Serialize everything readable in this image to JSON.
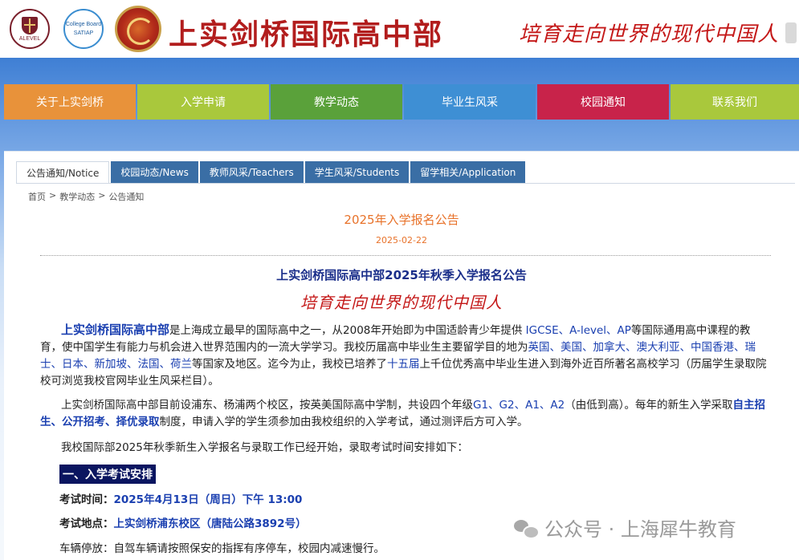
{
  "header": {
    "logo_alevel_text": "ALEVEL",
    "logo_cb_text": "College Board",
    "logo_cb_sub": "SATIAP",
    "school_name": "上实剑桥国际高中部",
    "slogan": "培育走向世界的现代中国人"
  },
  "nav": {
    "items": [
      {
        "label": "关于上实剑桥",
        "color": "#e8923a"
      },
      {
        "label": "入学申请",
        "color": "#a9c83c"
      },
      {
        "label": "教学动态",
        "color": "#5aa13a"
      },
      {
        "label": "毕业生风采",
        "color": "#3e8fd4"
      },
      {
        "label": "校园通知",
        "color": "#c8234a"
      },
      {
        "label": "联系我们",
        "color": "#a9c83c"
      }
    ]
  },
  "tabs": [
    {
      "label": "公告通知/Notice"
    },
    {
      "label": "校园动态/News"
    },
    {
      "label": "教师风采/Teachers"
    },
    {
      "label": "学生风采/Students"
    },
    {
      "label": "留学相关/Application"
    }
  ],
  "breadcrumb": {
    "home": "首页",
    "sep": ">",
    "level1": "教学动态",
    "level2": "公告通知"
  },
  "article": {
    "title": "2025年入学报名公告",
    "date": "2025-02-22",
    "heading": "上实剑桥国际高中部2025年秋季入学报名公告",
    "slogan": "培育走向世界的现代中国人",
    "p1": {
      "lead": "上实剑桥国际高中部",
      "a": "是上海成立最早的国际高中之一，从2008年开始即为中国适龄青少年提供 ",
      "courses": "IGCSE、A-level、AP",
      "b": "等国际通用高中课程的教育，使中国学生有能力与机会进入世界范围内的一流大学学习。我校历届高中毕业生主要留学目的地为",
      "countries": "英国、美国、加拿大、澳大利亚、中国香港、瑞士、日本、新加坡、法国、荷兰",
      "c": "等国家及地区。迄今为止，我校已培养了",
      "classes": "十五届",
      "d": "上千位优秀高中毕业生进入到海外近百所著名高校学习（历届学生录取院校可浏览我校官网毕业生风采栏目）。"
    },
    "p2": {
      "a": "上实剑桥国际高中部目前设浦东、杨浦两个校区，按英美国际高中学制，共设四个年级",
      "grades": "G1、G2、A1、A2",
      "b": "（由低到高）。每年的新生入学采取",
      "methods": "自主招生、公开招考、择优录取",
      "c": "制度，申请入学的学生须参加由我校组织的入学考试，通过测评后方可入学。"
    },
    "p3": "我校国际部2025年秋季新生入学报名与录取工作已经开始，录取考试时间安排如下：",
    "section1": "一、入学考试安排",
    "exam_time_label": "考试时间：",
    "exam_time": "2025年4月13日（周日）下午 13:00",
    "exam_place_label": "考试地点：",
    "exam_place": "上实剑桥浦东校区（唐陆公路3892号）",
    "parking_label": "车辆停放：",
    "parking": "自驾车辆请按照保安的指挥有序停车，校园内减速慢行。"
  },
  "watermark": "公众号 · 上海犀牛教育"
}
